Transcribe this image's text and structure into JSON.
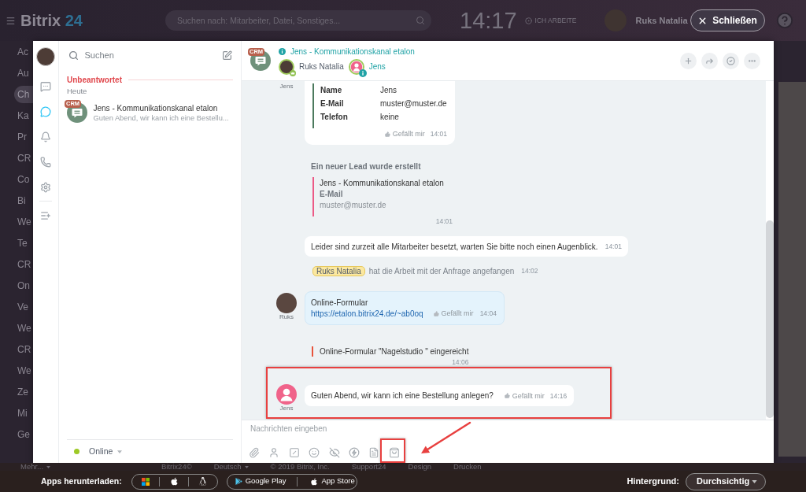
{
  "top_bar": {
    "logo": {
      "text": "Bitrix",
      "accent": "24"
    },
    "search": {
      "placeholder": "Suchen nach: Mitarbeiter, Datei, Sonstiges..."
    },
    "clock": "14:17",
    "work_status": "ICH ARBEITE",
    "user": {
      "name": "Ruks Natalia"
    },
    "close_button": "Schließen"
  },
  "background_menu": {
    "items": [
      {
        "label": "Ac",
        "selected": false
      },
      {
        "label": "Au",
        "selected": false
      },
      {
        "label": "Ch",
        "selected": true
      },
      {
        "label": "Ka",
        "selected": false
      },
      {
        "label": "Pr",
        "selected": false
      },
      {
        "label": "CR",
        "selected": false
      },
      {
        "label": "Co",
        "selected": false
      },
      {
        "label": "Bi",
        "selected": false
      },
      {
        "label": "We",
        "selected": false
      },
      {
        "label": "Te",
        "selected": false
      },
      {
        "label": "CR",
        "selected": false
      },
      {
        "label": "On",
        "selected": false
      },
      {
        "label": "Ve",
        "selected": false
      },
      {
        "label": "We",
        "selected": false
      },
      {
        "label": "CR",
        "selected": false
      },
      {
        "label": "We",
        "selected": false
      },
      {
        "label": "Ze",
        "selected": false
      },
      {
        "label": "Mi",
        "selected": false
      },
      {
        "label": "Ge",
        "selected": false
      }
    ],
    "more": "Mehr..."
  },
  "messenger": {
    "rail": [
      {
        "selected": false
      },
      {
        "selected": true
      },
      {
        "selected": false
      },
      {
        "selected": false
      },
      {
        "selected": false
      },
      {
        "selected": false
      }
    ],
    "recent": {
      "search_placeholder": "Suchen",
      "section": "Unbeantwortet",
      "group": "Heute",
      "items": [
        {
          "badge": "CRM",
          "title": "Jens - Kommunikationskanal etalon",
          "preview": "Guten Abend, wir kann ich eine Bestellu..."
        }
      ],
      "status": "Online"
    },
    "chat": {
      "badge": "CRM",
      "title": "Jens - Kommunikationskanal etalon",
      "members": [
        {
          "kind": "operator",
          "name": "Ruks Natalia"
        },
        {
          "kind": "client",
          "name": "Jens"
        }
      ],
      "messages": [
        {
          "kind": "form_card",
          "author": "Jens",
          "fields": [
            {
              "label": "Name",
              "value": "Jens"
            },
            {
              "label": "E-Mail",
              "value": "muster@muster.de"
            },
            {
              "label": "Telefon",
              "value": "keine"
            }
          ],
          "like": "Gefällt mir",
          "time": "14:01"
        },
        {
          "kind": "lead",
          "title": "Ein neuer Lead wurde erstellt",
          "lines": [
            {
              "kind": "name",
              "text": "Jens - Kommunikationskanal etalon"
            },
            {
              "kind": "label",
              "text": "E-Mail"
            },
            {
              "kind": "value",
              "text": "muster@muster.de"
            }
          ],
          "time": "14:01"
        },
        {
          "kind": "bot",
          "text": "Leider sind zurzeit alle Mitarbeiter besetzt, warten Sie bitte noch einen Augenblick.",
          "time": "14:01"
        },
        {
          "kind": "event",
          "tag": "Ruks Natalia",
          "text": "hat die Arbeit mit der Anfrage angefangen",
          "time": "14:02"
        },
        {
          "kind": "operator",
          "author": "Ruks",
          "text": "Online-Formular",
          "link": "https://etalon.bitrix24.de/~ab0oq",
          "like": "Gefällt mir",
          "time": "14:04"
        },
        {
          "kind": "notice",
          "text": "Online-Formular \"Nagelstudio \" eingereicht",
          "time": "14:06"
        },
        {
          "kind": "client",
          "author": "Jens",
          "text": "Guten Abend, wir kann ich eine Bestellung anlegen?",
          "like": "Gefällt mir",
          "time": "14:16",
          "annotated": true
        }
      ],
      "composer": {
        "placeholder": "Nachrichten eingeben",
        "tools": [
          {
            "annotated": false
          },
          {
            "annotated": false
          },
          {
            "annotated": false
          },
          {
            "annotated": false
          },
          {
            "annotated": false
          },
          {
            "annotated": false
          },
          {
            "annotated": false
          },
          {
            "annotated": true
          }
        ]
      }
    }
  },
  "annotation_arrow": true,
  "footer": {
    "links": [
      "Bitrix24©",
      "Deutsch",
      "© 2019 Bitrix, Inc.",
      "Support24",
      "Design",
      "Drucken"
    ]
  },
  "bottom_bar": {
    "apps_label": "Apps herunterladen:",
    "stores": [
      "Google Play",
      "App Store"
    ],
    "background_label": "Hintergrund:",
    "background_value": "Durchsichtig"
  }
}
